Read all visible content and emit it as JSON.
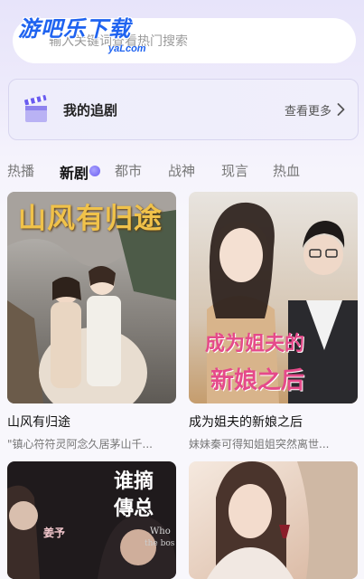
{
  "watermark": {
    "title": "游吧乐下载",
    "sub": "yaLcom"
  },
  "search": {
    "placeholder": "输入关键词查看热门搜索"
  },
  "watchlist": {
    "title": "我的追剧",
    "more": "查看更多"
  },
  "tabs": [
    "热播",
    "新剧",
    "都市",
    "战神",
    "现言",
    "热血"
  ],
  "active_tab": "新剧",
  "cards": [
    {
      "title": "山风有归途",
      "desc": "\"镇心符符灵阿念久居茅山千...",
      "poster_text": "山风有归途"
    },
    {
      "title": "成为姐夫的新娘之后",
      "desc": "妹妹秦可得知姐姐突然离世...",
      "poster_text_line1": "成为姐夫的",
      "poster_text_line2": "新娘之后"
    },
    {
      "poster_text_a": "谁摘",
      "poster_text_b": "傳总",
      "poster_small_1": "姜予",
      "poster_small_2": "Who",
      "poster_small_3": "the bos"
    },
    {}
  ],
  "colors": {
    "accent": "#6a5cf0",
    "brand": "#1f63f0",
    "poster_title_gold": "#f0c24a",
    "poster_title_pink": "#e54a8a"
  },
  "icons": {
    "clapper": "clapperboard-icon",
    "chevron": "chevron-right-icon"
  }
}
